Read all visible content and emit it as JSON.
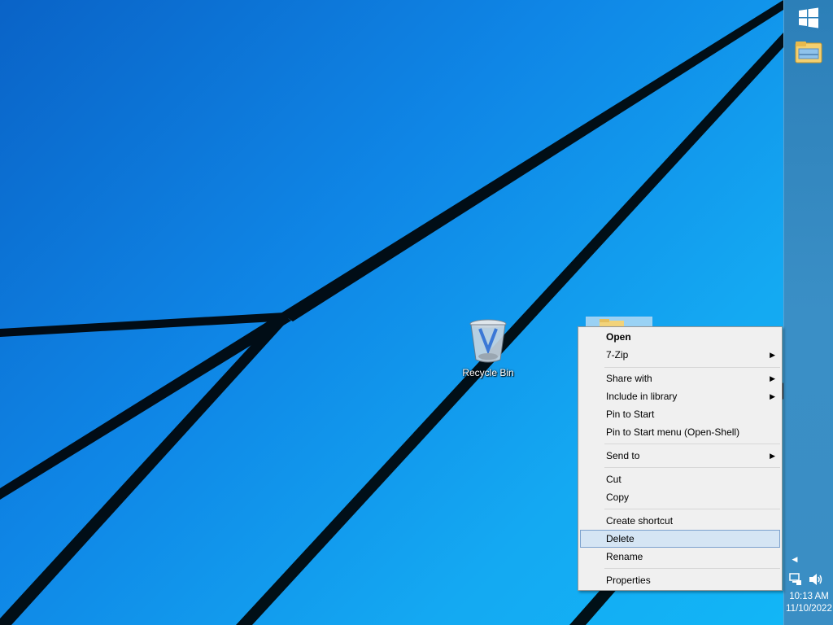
{
  "desktop": {
    "recycle_bin_label": "Recycle Bin"
  },
  "context_menu": {
    "items": [
      {
        "label": "Open",
        "bold": true
      },
      {
        "label": "7-Zip",
        "submenu": true
      },
      {
        "label": "Share with",
        "submenu": true
      },
      {
        "label": "Include in library",
        "submenu": true
      },
      {
        "label": "Pin to Start"
      },
      {
        "label": "Pin to Start menu (Open-Shell)"
      },
      {
        "label": "Send to",
        "submenu": true
      },
      {
        "label": "Cut"
      },
      {
        "label": "Copy"
      },
      {
        "label": "Create shortcut"
      },
      {
        "label": "Delete",
        "highlighted": true
      },
      {
        "label": "Rename"
      },
      {
        "label": "Properties"
      }
    ],
    "submenu_arrow": "▶"
  },
  "taskbar": {
    "start_icon": "windows-logo-icon",
    "pinned": [
      {
        "icon": "file-explorer-icon"
      }
    ],
    "tray": {
      "expand_glyph": "◀",
      "icons": [
        "network-icon",
        "volume-icon"
      ],
      "time": "10:13 AM",
      "date": "11/10/2022"
    }
  },
  "colors": {
    "wallpaper": "#0f86e6",
    "taskbar": "#3a8ec4",
    "menu_background": "#f0f0f0",
    "menu_highlight": "#d5e5f4"
  }
}
